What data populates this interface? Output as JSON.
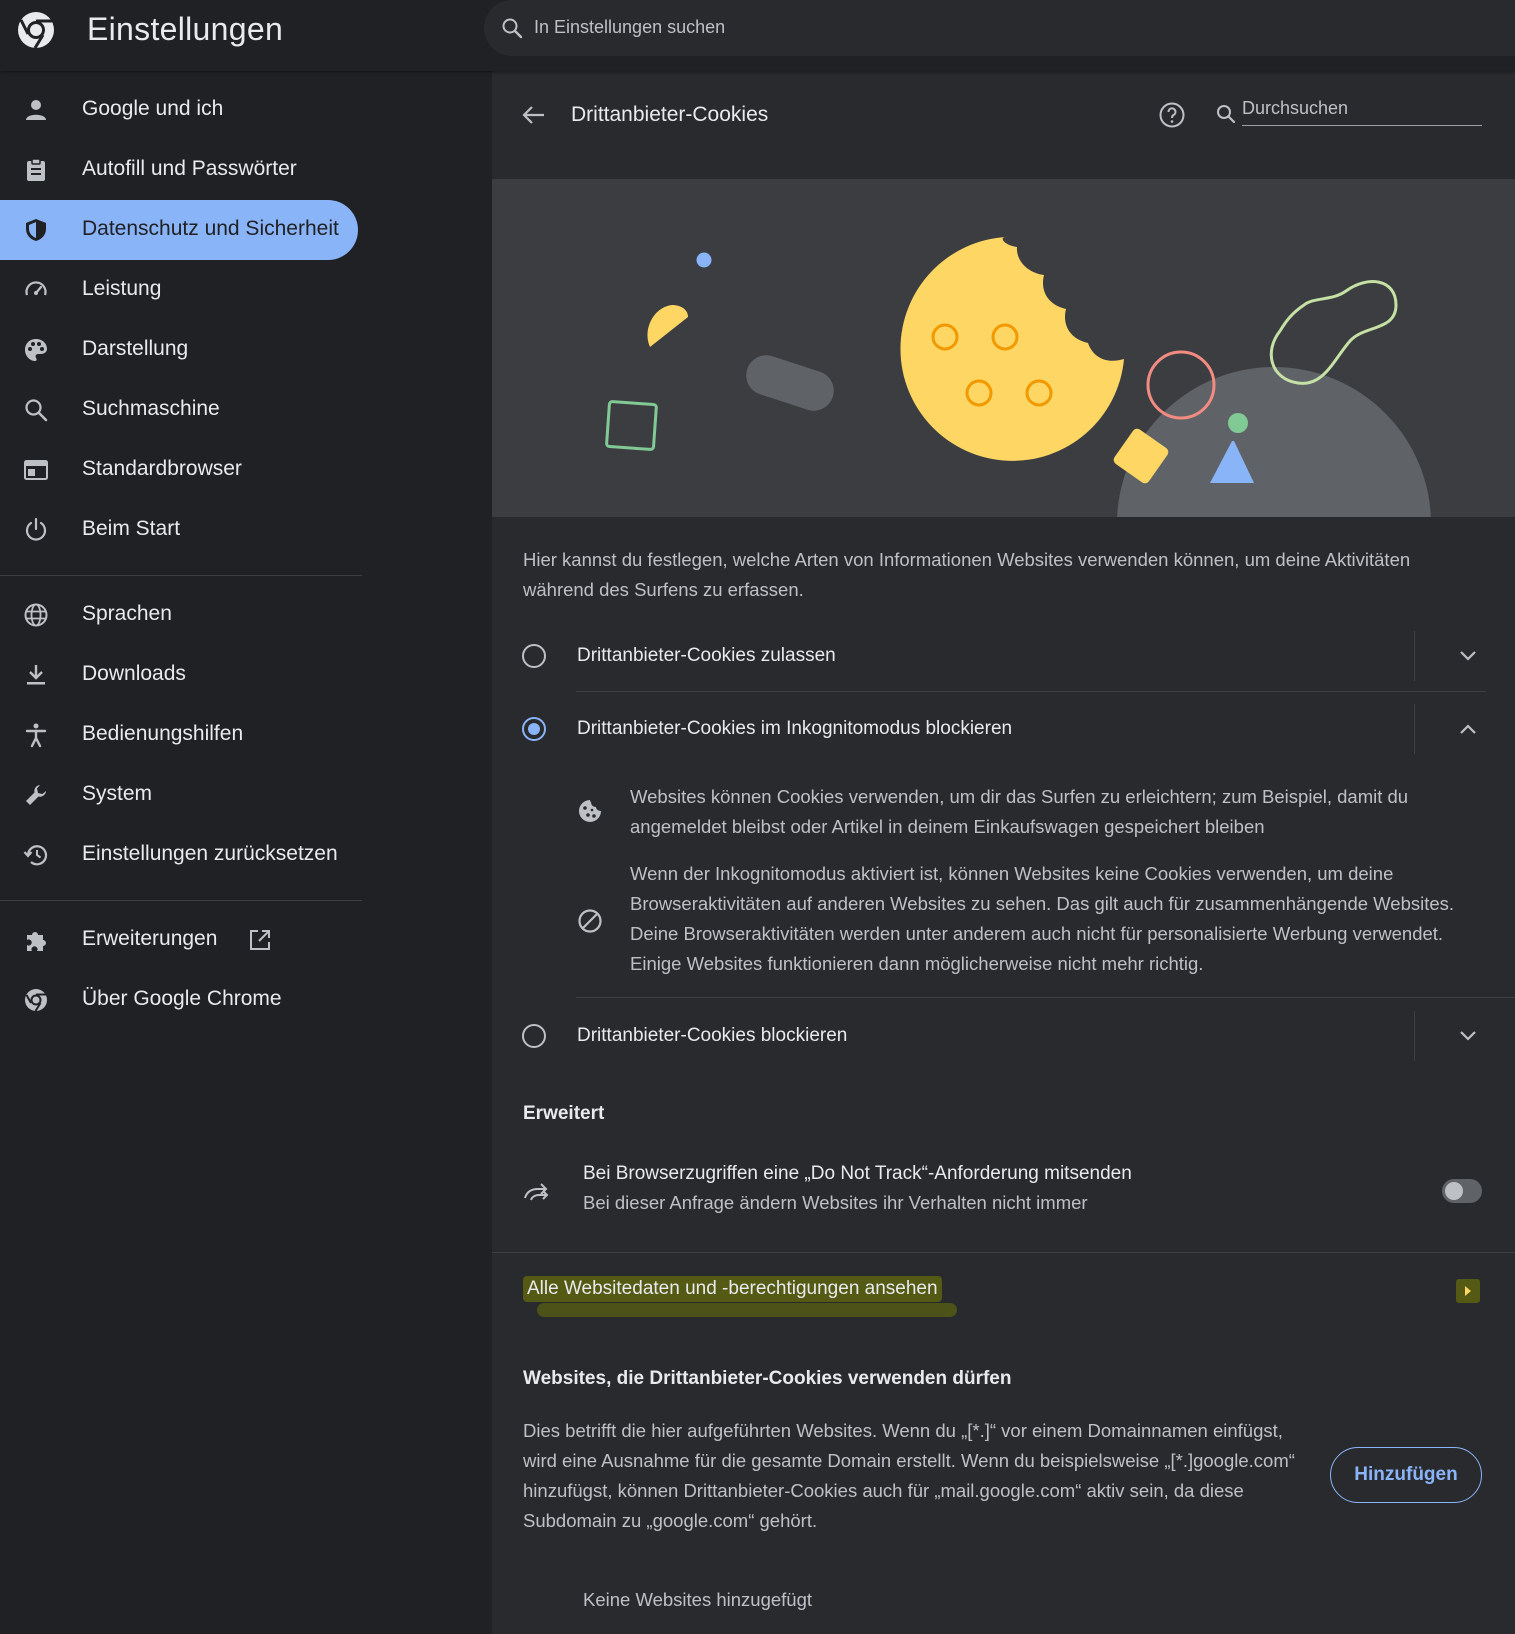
{
  "app": {
    "title": "Einstellungen",
    "search_placeholder": "In Einstellungen suchen",
    "accent": "#8ab4f8"
  },
  "sidebar": {
    "items": [
      {
        "label": "Google und ich",
        "icon": "person-icon"
      },
      {
        "label": "Autofill und Passwörter",
        "icon": "clipboard-icon"
      },
      {
        "label": "Datenschutz und Sicherheit",
        "icon": "shield-icon",
        "active": true
      },
      {
        "label": "Leistung",
        "icon": "speedometer-icon"
      },
      {
        "label": "Darstellung",
        "icon": "palette-icon"
      },
      {
        "label": "Suchmaschine",
        "icon": "search-icon"
      },
      {
        "label": "Standardbrowser",
        "icon": "browser-window-icon"
      },
      {
        "label": "Beim Start",
        "icon": "power-icon"
      },
      {
        "label": "Sprachen",
        "icon": "globe-icon"
      },
      {
        "label": "Downloads",
        "icon": "download-icon"
      },
      {
        "label": "Bedienungshilfen",
        "icon": "accessibility-icon"
      },
      {
        "label": "System",
        "icon": "wrench-icon"
      },
      {
        "label": "Einstellungen zurücksetzen",
        "icon": "restore-icon"
      },
      {
        "label": "Erweiterungen",
        "icon": "puzzle-icon"
      },
      {
        "label": "Über Google Chrome",
        "icon": "chrome-icon"
      }
    ]
  },
  "page": {
    "title": "Drittanbieter-Cookies",
    "search_placeholder": "Durchsuchen",
    "intro": "Hier kannst du festlegen, welche Arten von Informationen Websites verwenden können, um deine Aktivitäten während des Surfens zu erfassen.",
    "options": [
      {
        "label": "Drittanbieter-Cookies zulassen",
        "checked": false
      },
      {
        "label": "Drittanbieter-Cookies im Inkognitomodus blockieren",
        "checked": true
      },
      {
        "label": "Drittanbieter-Cookies blockieren",
        "checked": false
      }
    ],
    "details": [
      {
        "icon": "cookie-icon",
        "text": "Websites können Cookies verwenden, um dir das Surfen zu erleichtern; zum Beispiel, damit du angemeldet bleibst oder Artikel in deinem Einkaufswagen gespeichert bleiben"
      },
      {
        "icon": "block-icon",
        "text": "Wenn der Inkognitomodus aktiviert ist, können Websites keine Cookies verwenden, um deine Browseraktivitäten auf anderen Websites zu sehen. Das gilt auch für zusammenhängende Websites. Deine Browseraktivitäten werden unter anderem auch nicht für personalisierte Werbung verwendet. Einige Websites funktionieren dann möglicherweise nicht mehr richtig."
      }
    ],
    "advanced": {
      "heading": "Erweitert",
      "dnt_title": "Bei Browserzugriffen eine „Do Not Track“-Anforderung mitsenden",
      "dnt_subtitle": "Bei dieser Anfrage ändern Websites ihr Verhalten nicht immer",
      "dnt_enabled": false
    },
    "all_site_data": "Alle Websitedaten und -berechtigungen ansehen",
    "allowed": {
      "heading": "Websites, die Drittanbieter-Cookies verwenden dürfen",
      "description": "Dies betrifft die hier aufgeführten Websites. Wenn du „[*.]“ vor einem Domainnamen einfügst, wird eine Ausnahme für die gesamte Domain erstellt. Wenn du beispielsweise „[*.]google.com“ hinzufügst, können Drittanbieter-Cookies auch für „mail.google.com“ aktiv sein, da diese Subdomain zu „google.com“ gehört.",
      "add_label": "Hinzufügen",
      "empty": "Keine Websites hinzugefügt"
    }
  }
}
